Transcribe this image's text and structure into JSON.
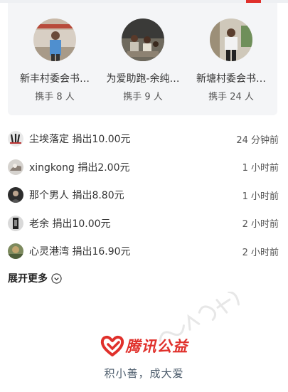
{
  "teams": [
    {
      "name": "新丰村委会书…",
      "count": "携手 8 人"
    },
    {
      "name": "为爱助跑-余纯…",
      "count": "携手 9 人"
    },
    {
      "name": "新塘村委会书…",
      "count": "携手 24 人"
    }
  ],
  "donations": [
    {
      "text": "尘埃落定 捐出10.00元",
      "time": "24 分钟前"
    },
    {
      "text": "xingkong 捐出2.00元",
      "time": "1 小时前"
    },
    {
      "text": "那个男人 捐出8.80元",
      "time": "1 小时前"
    },
    {
      "text": "老余 捐出10.00元",
      "time": "2 小时前"
    },
    {
      "text": "心灵港湾 捐出16.90元",
      "time": "2 小时前"
    }
  ],
  "expand_label": "展开更多",
  "footer": {
    "logo_text": "腾讯公益",
    "slogan": "积小善，成大爱"
  },
  "colors": {
    "brand_red": "#e0302b",
    "card_bg": "#f4f5f7"
  }
}
